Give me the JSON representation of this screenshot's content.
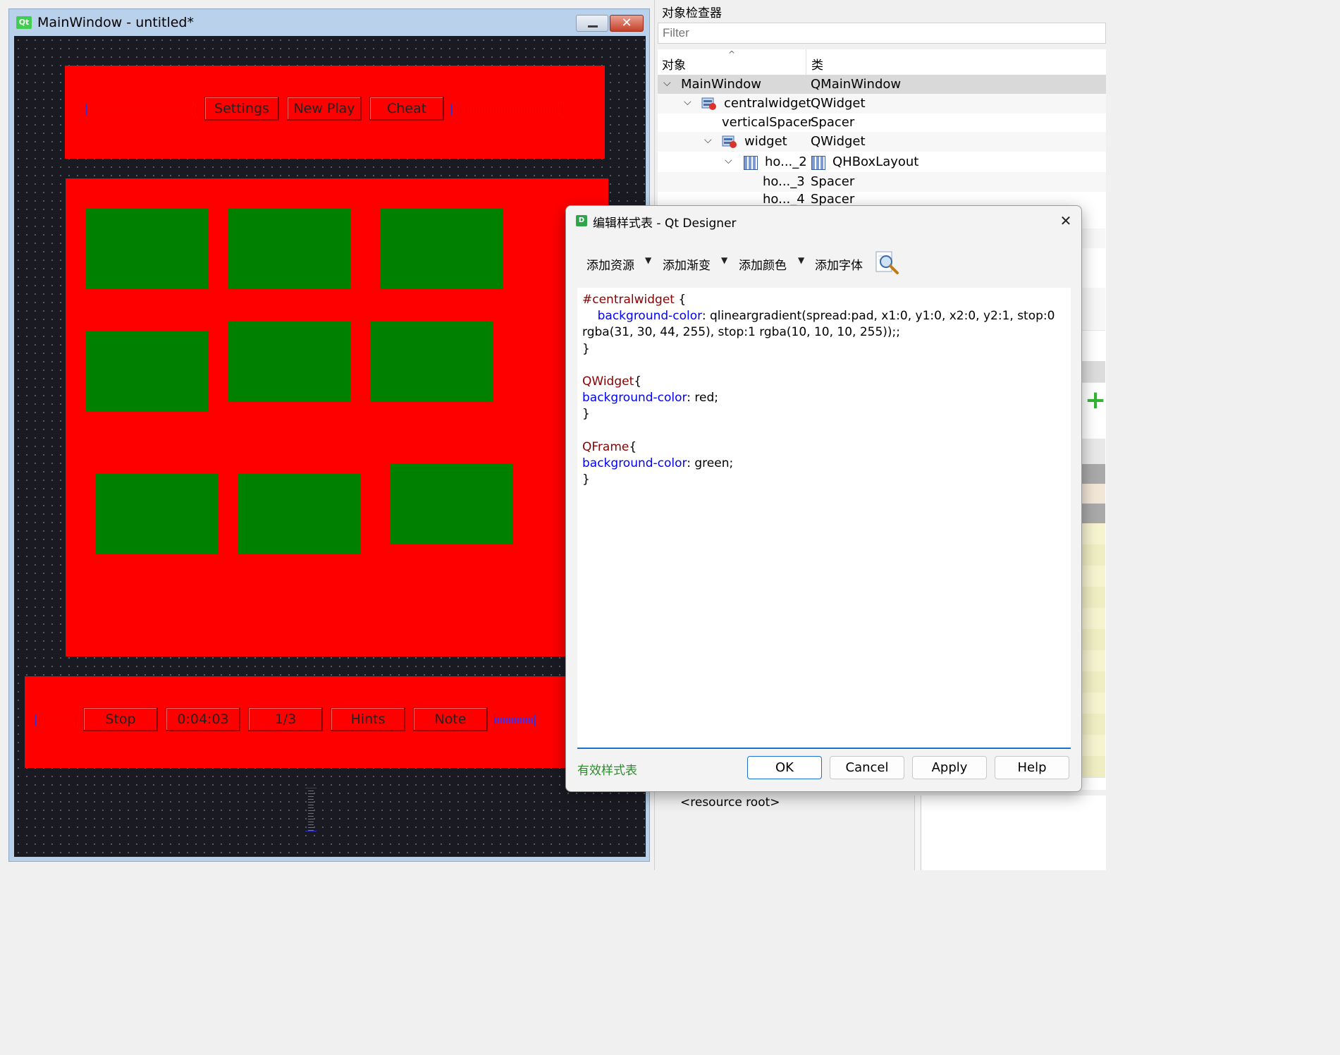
{
  "main_window": {
    "title": "MainWindow - untitled*",
    "logo_text": "Qt",
    "close_glyph": "✕",
    "top_bar": {
      "buttons": [
        "Settings",
        "New Play",
        "Cheat"
      ]
    },
    "bottom_bar": {
      "buttons": [
        "Stop",
        "0:04:03",
        "1/3",
        "Hints",
        "Note"
      ]
    },
    "colors": {
      "canvas_bg": "#1a1a22",
      "widget_bg": "#ff0000",
      "frame_bg": "#008000",
      "spacer": "#3030ff"
    }
  },
  "object_inspector": {
    "title": "对象检查器",
    "filter_placeholder": "Filter",
    "header": {
      "object": "对象",
      "class": "类",
      "sort_glyph": "^"
    },
    "rows": [
      {
        "name": "MainWindow",
        "class": "QMainWindow"
      },
      {
        "name": "centralwidget",
        "class": "QWidget"
      },
      {
        "name": "verticalSpacer",
        "class": "Spacer"
      },
      {
        "name": "widget",
        "class": "QWidget"
      },
      {
        "name": "ho..._2",
        "class": "QHBoxLayout"
      },
      {
        "name": "ho..._3",
        "class": "Spacer"
      },
      {
        "name": "ho..._4",
        "class": "Spacer"
      }
    ],
    "resource_root": "<resource root>",
    "add_glyph": "+"
  },
  "dialog": {
    "logo_text": "D",
    "title": "编辑样式表 - Qt Designer",
    "close_glyph": "✕",
    "toolbar": {
      "add_resource": "添加资源",
      "add_gradient": "添加渐变",
      "add_color": "添加颜色",
      "add_font": "添加字体",
      "dropdown_glyph": "▼"
    },
    "code": {
      "block1_selector": "#centralwidget",
      "block1_open": " {",
      "block1_prop": "background-color",
      "block1_value_line1": ": qlineargradient(spread:pad, x1:0, y1:0, x2:0, y2:1, stop:0",
      "block1_value_line2": "rgba(31, 30, 44, 255), stop:1 rgba(10, 10, 10, 255));;",
      "close_brace": "}",
      "block2_selector": "QWidget",
      "block2_open": "{",
      "block2_prop": "background-color",
      "block2_value": ": red;",
      "block3_selector": "QFrame",
      "block3_open": "{",
      "block3_prop": "background-color",
      "block3_value": ": green;"
    },
    "status": "有效样式表",
    "buttons": {
      "ok": "OK",
      "cancel": "Cancel",
      "apply": "Apply",
      "help": "Help"
    },
    "colors": {
      "selector": "#8b0000",
      "property": "#0000ff",
      "status": "#2e8b2e",
      "focus": "#1f6fd1"
    }
  }
}
